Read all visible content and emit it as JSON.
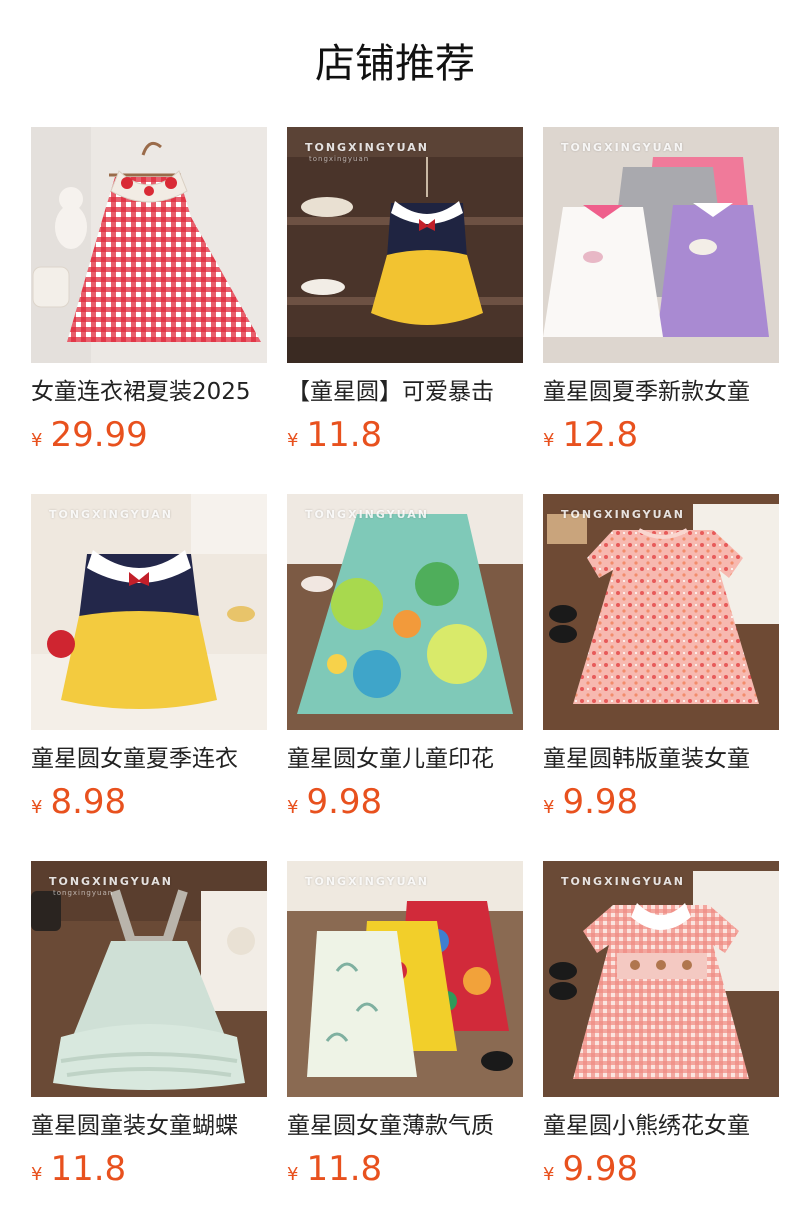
{
  "section": {
    "title": "店铺推荐"
  },
  "colors": {
    "price": "#e8511e",
    "text": "#222222"
  },
  "products": [
    {
      "name": "女童连衣裙夏装2025",
      "currency": "¥",
      "price": "29.99",
      "watermark": "",
      "watermark_sub": "",
      "image": "red-gingham-dress"
    },
    {
      "name": "【童星圆】可爱暴击",
      "currency": "¥",
      "price": "11.8",
      "watermark": "TONGXINGYUAN",
      "watermark_sub": "tongxingyuan",
      "image": "navy-yellow-princess-dress"
    },
    {
      "name": "童星圆夏季新款女童",
      "currency": "¥",
      "price": "12.8",
      "watermark": "TONGXINGYUAN",
      "watermark_sub": "",
      "image": "polo-ruffle-dresses"
    },
    {
      "name": "童星圆女童夏季连衣",
      "currency": "¥",
      "price": "8.98",
      "watermark": "TONGXINGYUAN",
      "watermark_sub": "",
      "image": "navy-yellow-dress-worn"
    },
    {
      "name": "童星圆女童儿童印花",
      "currency": "¥",
      "price": "9.98",
      "watermark": "TONGXINGYUAN",
      "watermark_sub": "",
      "image": "green-print-dress"
    },
    {
      "name": "童星圆韩版童装女童",
      "currency": "¥",
      "price": "9.98",
      "watermark": "TONGXINGYUAN",
      "watermark_sub": "",
      "image": "pink-floral-dress"
    },
    {
      "name": "童星圆童装女童蝴蝶",
      "currency": "¥",
      "price": "11.8",
      "watermark": "TONGXINGYUAN",
      "watermark_sub": "tongxingyuan",
      "image": "mint-tulle-dress"
    },
    {
      "name": "童星圆女童薄款气质",
      "currency": "¥",
      "price": "11.8",
      "watermark": "TONGXINGYUAN",
      "watermark_sub": "",
      "image": "cheongsam-dresses"
    },
    {
      "name": "童星圆小熊绣花女童",
      "currency": "¥",
      "price": "9.98",
      "watermark": "TONGXINGYUAN",
      "watermark_sub": "",
      "image": "pink-check-smocked-dress"
    }
  ]
}
